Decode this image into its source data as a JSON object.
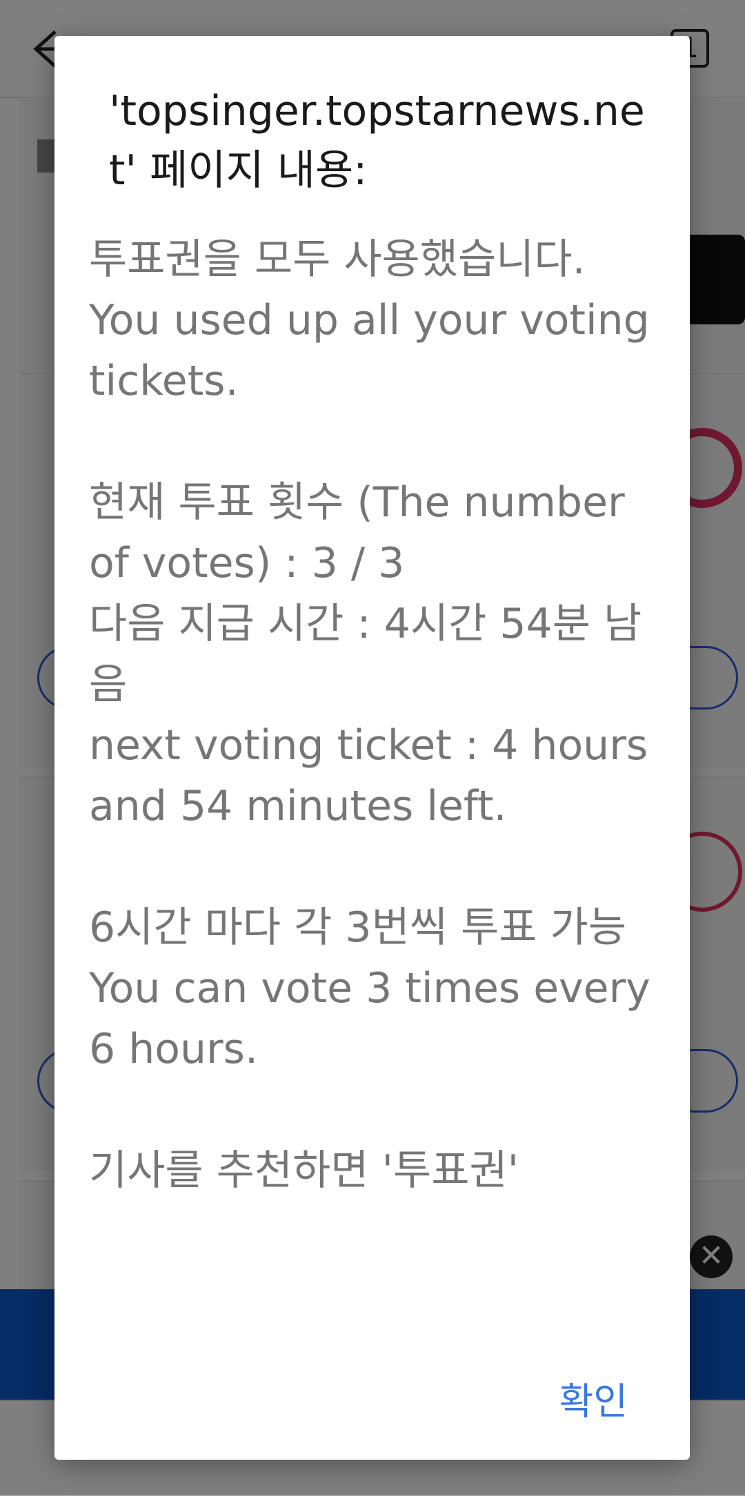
{
  "browser": {
    "tab_count": "1"
  },
  "dialog": {
    "title": "'topsinger.topstarnews.net' 페이지 내용:",
    "message": "투표권을 모두 사용했습니다.\nYou used up all your voting tickets.\n\n현재 투표 횟수 (The number of votes) : 3 / 3\n다음 지급 시간 : 4시간 54분 남음\nnext voting ticket : 4 hours and 54 minutes left.\n\n6시간 마다 각 3번씩 투표 가능\nYou can vote 3 times every 6 hours.\n\n기사를 추천하면 '투표권'",
    "ok_label": "확인"
  },
  "colors": {
    "accent": "#3a78e0",
    "heart": "#e0305e",
    "banner": "#0b58c9"
  }
}
